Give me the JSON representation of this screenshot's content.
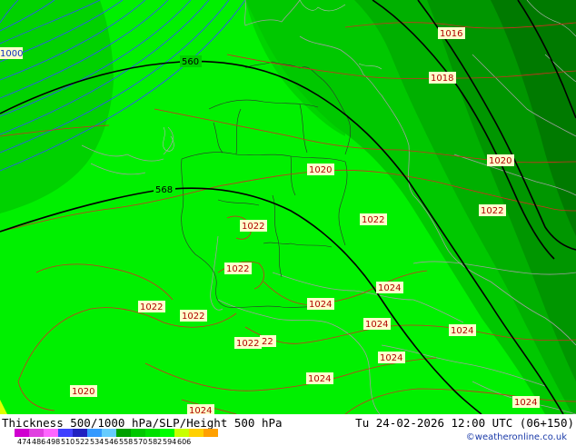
{
  "footer": {
    "title": "Thickness 500/1000 hPa/SLP/Height 500 hPa",
    "datetime": "Tu 24-02-2026 12:00 UTC (06+150)",
    "credit": "©weatheronline.co.uk"
  },
  "legend": {
    "ticks": [
      "474",
      "486",
      "498",
      "510",
      "522",
      "534",
      "546",
      "558",
      "570",
      "582",
      "594",
      "606"
    ],
    "colors": [
      "#d000d0",
      "#e040e0",
      "#ff66ff",
      "#4040ff",
      "#2020c0",
      "#3399ff",
      "#66ccff",
      "#00a000",
      "#00c800",
      "#00e000",
      "#00ff00",
      "#c8ff00",
      "#ffd000",
      "#ffa000"
    ]
  },
  "map": {
    "isobars_hpa": {
      "i1000": "1000",
      "i1016": "1016",
      "i1018": "1018",
      "i1020a": "1020",
      "i1020b": "1020",
      "i1020c": "1020",
      "i1022a": "1022",
      "i1022b": "1022",
      "i1022c": "1022",
      "i1022d": "1022",
      "i1022e": "1022",
      "i1022f": "1022",
      "i1022g": "1022",
      "i1022h": "22",
      "i1024a": "1024",
      "i1024b": "1024",
      "i1024c": "1024",
      "i1024d": "1024",
      "i1024e": "1024",
      "i1024f": "1024",
      "i1024g": "1024",
      "i1024h": "1024"
    },
    "height_500": {
      "h560": "560",
      "h568": "568"
    }
  }
}
